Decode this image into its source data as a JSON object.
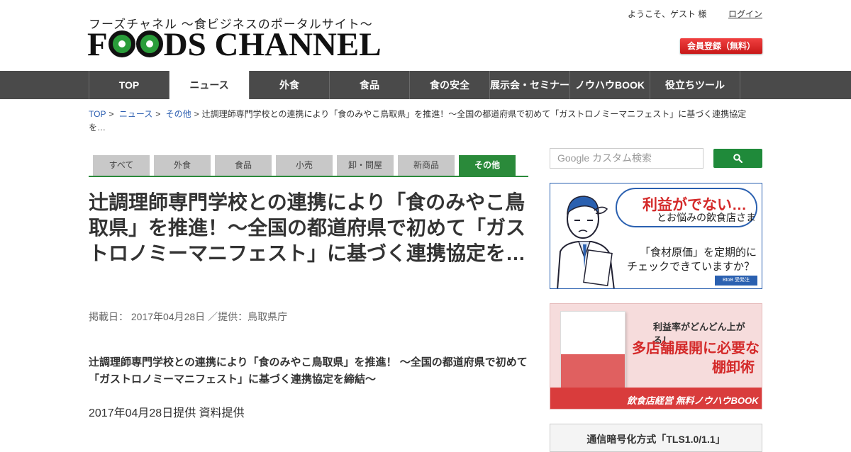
{
  "header": {
    "logo_sub": "フーズチャネル ～食ビジネスのポータルサイト～",
    "logo_part1": "F",
    "logo_part2": "DS CHANNEL",
    "welcome": "ようこそ、ゲスト 様",
    "login": "ログイン",
    "register": "会員登録（無料）"
  },
  "nav": {
    "items": [
      "TOP",
      "ニュース",
      "外食",
      "食品",
      "食の安全",
      "展示会・セミナー",
      "ノウハウBOOK",
      "役立ちツール"
    ],
    "active_index": 1
  },
  "breadcrumb": {
    "top": "TOP",
    "news": "ニュース",
    "other": "その他",
    "current": "辻調理師専門学校との連携により「食のみやこ鳥取県」を推進！～全国の都道府県で初めて「ガストロノミーマニフェスト」に基づく連携協定を…",
    "sep": ">"
  },
  "tabs": [
    "すべて",
    "外食",
    "食品",
    "小売",
    "卸・問屋",
    "新商品",
    "その他"
  ],
  "tabs_active_index": 6,
  "article": {
    "title": "辻調理師専門学校との連携により「食のみやこ鳥取県」を推進！～全国の都道府県で初めて「ガストロノミーマニフェスト」に基づく連携協定を…",
    "meta": "掲載日： 2017年04月28日 ／提供：鳥取県庁",
    "lead": "辻調理師専門学校との連携により「食のみやこ鳥取県」を推進！ ～全国の都道府県で初めて「ガストロノミーマニフェスト」に基づく連携協定を締結～",
    "date_line": "2017年04月28日提供 資料提供"
  },
  "sidebar": {
    "search_placeholder": "Google カスタム検索",
    "search_icon": "search-icon",
    "banner1": {
      "headline": "利益がでない…",
      "sub": "とお悩みの飲食店さま",
      "q1": "「食材原価」を定期的に",
      "q2": "チェックできていますか？",
      "tag": "BtoB 受発注"
    },
    "banner2": {
      "line1": "利益率がどんどん上がる！",
      "line2": "多店舗展開に必要な",
      "line3": "棚卸術",
      "footer": "飲食店経営 無料ノウハウBOOK"
    },
    "box3": "通信暗号化方式「TLS1.0/1.1」"
  },
  "colors": {
    "accent_green": "#2a8a3a",
    "nav_bg": "#4a4a4a",
    "register_red": "#d42a2a",
    "link_blue": "#2a5db0"
  }
}
